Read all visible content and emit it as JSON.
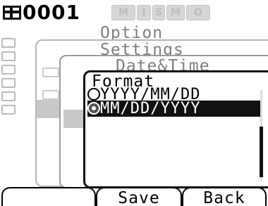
{
  "status": {
    "sample_number": "0001",
    "mode_icons": [
      "M",
      "I",
      "S",
      "M",
      "O"
    ]
  },
  "menus": {
    "option_title": "Option",
    "settings_title": "Settings",
    "date_time_title": "Date&Time",
    "format_title": "Format",
    "format_options": [
      {
        "label": "YYYY/MM/DD",
        "selected": false
      },
      {
        "label": "MM/DD/YYYY",
        "selected": true
      }
    ]
  },
  "softkeys": {
    "key1_label": "",
    "save_label": "Save",
    "back_label": "Back"
  }
}
